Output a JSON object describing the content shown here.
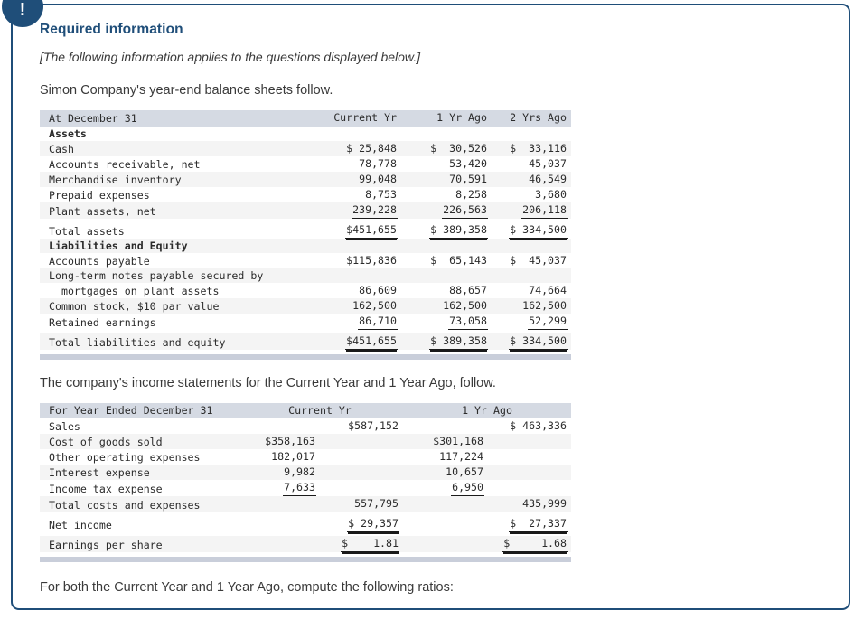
{
  "badge": {
    "glyph": "!",
    "name": "alert-exclamation"
  },
  "header": {
    "title": "Required information"
  },
  "notes": {
    "applies": "[The following information applies to the questions displayed below.]",
    "balance_lead": "Simon Company's year-end balance sheets follow.",
    "income_lead": "The company's income statements for the Current Year and 1 Year Ago, follow.",
    "ratios_prompt": "For both the Current Year and 1 Year Ago, compute the following ratios:"
  },
  "colors": {
    "border": "#1f4e79",
    "heading": "#1f4e79",
    "table_header_bg": "#d5dae3",
    "row_stripe": "#f4f4f4",
    "footer_bar": "#c9ceda"
  },
  "balance_sheet": {
    "columns": [
      "At December 31",
      "Current Yr",
      "1 Yr Ago",
      "2 Yrs Ago"
    ],
    "rows": [
      {
        "label": "Assets",
        "bold": true,
        "values": [
          "",
          "",
          ""
        ]
      },
      {
        "label": "Cash",
        "values": [
          "$ 25,848",
          "$  30,526",
          "$  33,116"
        ]
      },
      {
        "label": "Accounts receivable, net",
        "values": [
          "78,778",
          "53,420",
          "45,037"
        ]
      },
      {
        "label": "Merchandise inventory",
        "values": [
          "99,048",
          "70,591",
          "46,549"
        ]
      },
      {
        "label": "Prepaid expenses",
        "values": [
          "8,753",
          "8,258",
          "3,680"
        ]
      },
      {
        "label": "Plant assets, net",
        "values": [
          "239,228",
          "226,563",
          "206,118"
        ],
        "rule": 1
      },
      {
        "label": "Total assets",
        "values": [
          "$451,655",
          "$ 389,358",
          "$ 334,500"
        ],
        "rule": 2,
        "gap_before": true
      },
      {
        "label": "Liabilities and Equity",
        "bold": true,
        "values": [
          "",
          "",
          ""
        ]
      },
      {
        "label": "Accounts payable",
        "values": [
          "$115,836",
          "$  65,143",
          "$  45,037"
        ]
      },
      {
        "label": "Long-term notes payable secured by",
        "values": [
          "",
          "",
          ""
        ]
      },
      {
        "label": "  mortgages on plant assets",
        "values": [
          "86,609",
          "88,657",
          "74,664"
        ]
      },
      {
        "label": "Common stock, $10 par value",
        "values": [
          "162,500",
          "162,500",
          "162,500"
        ]
      },
      {
        "label": "Retained earnings",
        "values": [
          "86,710",
          "73,058",
          "52,299"
        ],
        "rule": 1
      },
      {
        "label": "Total liabilities and equity",
        "values": [
          "$451,655",
          "$ 389,358",
          "$ 334,500"
        ],
        "rule": 2,
        "gap_before": true
      }
    ]
  },
  "income_statement": {
    "columns": [
      "For Year Ended December 31",
      "Current Yr",
      "1 Yr Ago"
    ],
    "rows": [
      {
        "label": "Sales",
        "cy_sub": "",
        "cy_tot": "$587,152",
        "py_sub": "",
        "py_tot": "$ 463,336"
      },
      {
        "label": "Cost of goods sold",
        "cy_sub": "$358,163",
        "cy_tot": "",
        "py_sub": "$301,168",
        "py_tot": ""
      },
      {
        "label": "Other operating expenses",
        "cy_sub": "182,017",
        "cy_tot": "",
        "py_sub": "117,224",
        "py_tot": ""
      },
      {
        "label": "Interest expense",
        "cy_sub": "9,982",
        "cy_tot": "",
        "py_sub": "10,657",
        "py_tot": ""
      },
      {
        "label": "Income tax expense",
        "cy_sub": "7,633",
        "cy_tot": "",
        "py_sub": "6,950",
        "py_tot": "",
        "rule_sub": 1
      },
      {
        "label": "Total costs and expenses",
        "cy_sub": "",
        "cy_tot": "557,795",
        "py_sub": "",
        "py_tot": "435,999",
        "rule_tot": 1
      },
      {
        "label": "Net income",
        "cy_sub": "",
        "cy_tot": "$ 29,357",
        "py_sub": "",
        "py_tot": "$  27,337",
        "rule_tot": 2,
        "gap_before": true
      },
      {
        "label": "Earnings per share",
        "cy_sub": "",
        "cy_tot": "$    1.81",
        "py_sub": "",
        "py_tot": "$     1.68",
        "rule_tot": 2,
        "gap_before": true
      }
    ]
  }
}
